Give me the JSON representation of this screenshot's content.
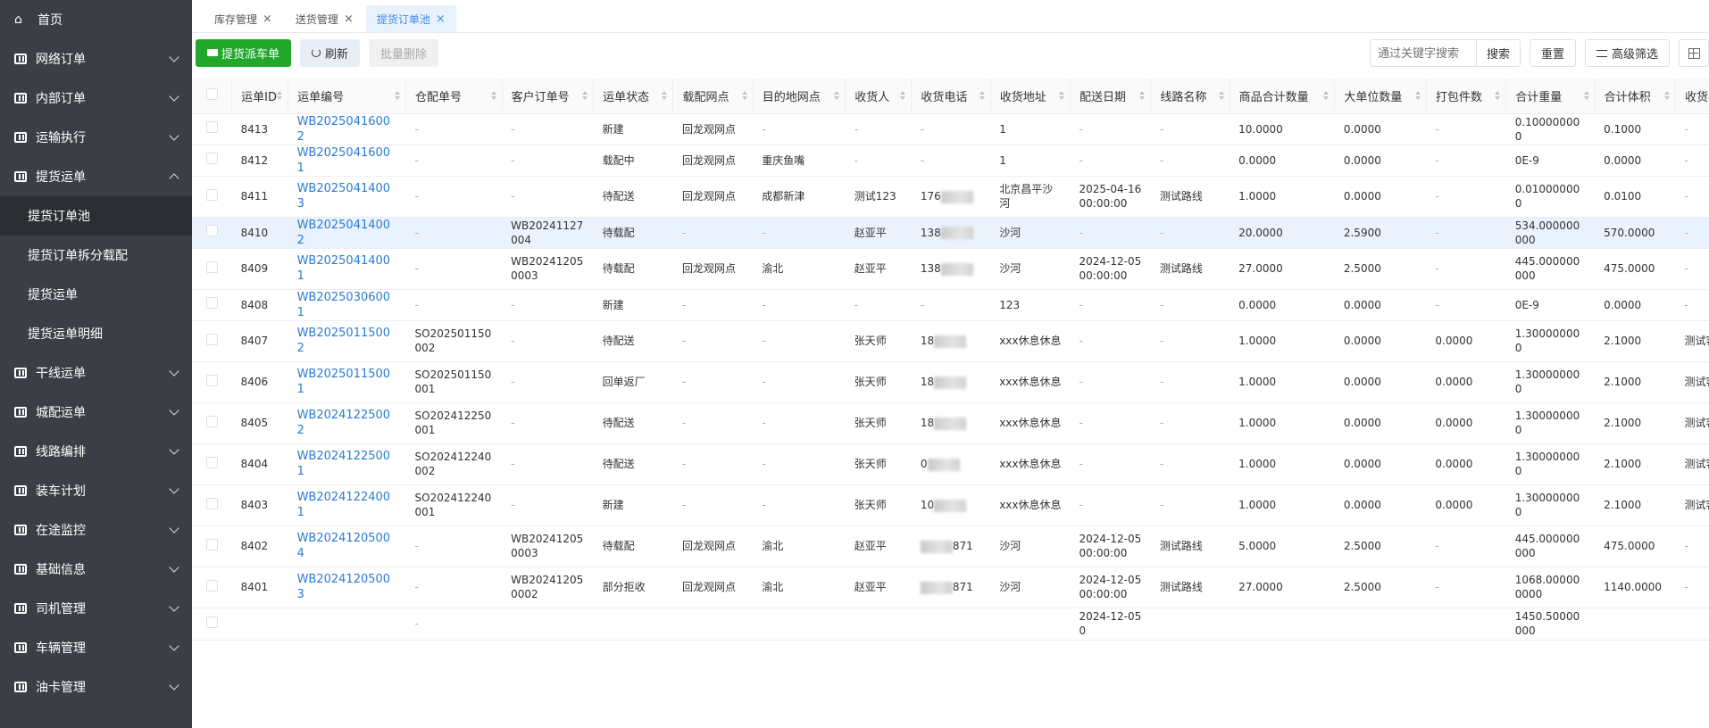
{
  "sidebar": {
    "home": "首页",
    "items": [
      {
        "label": "网络订单",
        "expanded": false
      },
      {
        "label": "内部订单",
        "expanded": false
      },
      {
        "label": "运输执行",
        "expanded": false
      },
      {
        "label": "提货运单",
        "expanded": true
      }
    ],
    "sub_items": [
      {
        "label": "提货订单池",
        "active": true
      },
      {
        "label": "提货订单拆分载配",
        "active": false
      },
      {
        "label": "提货运单",
        "active": false
      },
      {
        "label": "提货运单明细",
        "active": false
      }
    ],
    "items_after": [
      {
        "label": "干线运单"
      },
      {
        "label": "城配运单"
      },
      {
        "label": "线路编排"
      },
      {
        "label": "装车计划"
      },
      {
        "label": "在途监控"
      },
      {
        "label": "基础信息"
      },
      {
        "label": "司机管理"
      },
      {
        "label": "车辆管理"
      },
      {
        "label": "油卡管理"
      }
    ]
  },
  "tabs": [
    {
      "label": "库存管理",
      "active": false
    },
    {
      "label": "送货管理",
      "active": false
    },
    {
      "label": "提货订单池",
      "active": true
    }
  ],
  "toolbar": {
    "dispatch_label": "提货派车单",
    "refresh_label": "刷新",
    "batch_delete_label": "批量删除",
    "search_placeholder": "通过关键字搜索",
    "search_label": "搜索",
    "reset_label": "重置",
    "advanced_filter_label": "高级筛选"
  },
  "table": {
    "columns": [
      "运单ID",
      "运单编号",
      "仓配单号",
      "客户订单号",
      "运单状态",
      "载配网点",
      "目的地网点",
      "收货人",
      "收货电话",
      "收货地址",
      "配送日期",
      "线路名称",
      "商品合计数量",
      "大单位数量",
      "打包件数",
      "合计重量",
      "合计体积",
      "收货客"
    ],
    "rows": [
      {
        "id": "8413",
        "no": "WB20250416002",
        "wh": "-",
        "cust": "-",
        "status": "新建",
        "site": "回龙观网点",
        "dest": "-",
        "recv": "-",
        "phone": "-",
        "addr": "1",
        "date": "-",
        "line": "-",
        "qty": "10.0000",
        "big": "0.0000",
        "pack": "-",
        "weight": "0.100000000",
        "vol": "0.1000",
        "rc": "-"
      },
      {
        "id": "8412",
        "no": "WB20250416001",
        "wh": "-",
        "cust": "-",
        "status": "载配中",
        "site": "回龙观网点",
        "dest": "重庆鱼嘴",
        "recv": "-",
        "phone": "-",
        "addr": "1",
        "date": "-",
        "line": "-",
        "qty": "0.0000",
        "big": "0.0000",
        "pack": "-",
        "weight": "0E-9",
        "vol": "0.0000",
        "rc": "-"
      },
      {
        "id": "8411",
        "no": "WB20250414003",
        "wh": "-",
        "cust": "-",
        "status": "待配送",
        "site": "回龙观网点",
        "dest": "成都新津",
        "recv": "测试123",
        "phone": "176",
        "addr": "北京昌平沙河",
        "date": "2025-04-16 00:00:00",
        "line": "测试路线",
        "qty": "1.0000",
        "big": "0.0000",
        "pack": "-",
        "weight": "0.010000000",
        "vol": "0.0100",
        "rc": "-"
      },
      {
        "id": "8410",
        "no": "WB20250414002",
        "wh": "-",
        "cust": "WB20241127004",
        "status": "待载配",
        "site": "-",
        "dest": "-",
        "recv": "赵亚平",
        "phone": "138",
        "addr": "沙河",
        "date": "-",
        "line": "-",
        "qty": "20.0000",
        "big": "2.5900",
        "pack": "-",
        "weight": "534.000000000",
        "vol": "570.0000",
        "rc": "-"
      },
      {
        "id": "8409",
        "no": "WB20250414001",
        "wh": "-",
        "cust": "WB202412050003",
        "status": "待载配",
        "site": "回龙观网点",
        "dest": "渝北",
        "recv": "赵亚平",
        "phone": "138",
        "addr": "沙河",
        "date": "2024-12-05 00:00:00",
        "line": "测试路线",
        "qty": "27.0000",
        "big": "2.5000",
        "pack": "-",
        "weight": "445.000000000",
        "vol": "475.0000",
        "rc": "-"
      },
      {
        "id": "8408",
        "no": "WB20250306001",
        "wh": "-",
        "cust": "-",
        "status": "新建",
        "site": "-",
        "dest": "-",
        "recv": "-",
        "phone": "-",
        "addr": "123",
        "date": "-",
        "line": "-",
        "qty": "0.0000",
        "big": "0.0000",
        "pack": "-",
        "weight": "0E-9",
        "vol": "0.0000",
        "rc": "-"
      },
      {
        "id": "8407",
        "no": "WB20250115002",
        "wh": "SO202501150002",
        "cust": "-",
        "status": "待配送",
        "site": "-",
        "dest": "-",
        "recv": "张天师",
        "phone": "18",
        "addr": "xxx休息休息",
        "date": "-",
        "line": "-",
        "qty": "1.0000",
        "big": "0.0000",
        "pack": "0.0000",
        "weight": "1.300000000",
        "vol": "2.1000",
        "rc": "测试客"
      },
      {
        "id": "8406",
        "no": "WB20250115001",
        "wh": "SO202501150001",
        "cust": "-",
        "status": "回单返厂",
        "site": "-",
        "dest": "-",
        "recv": "张天师",
        "phone": "18",
        "addr": "xxx休息休息",
        "date": "-",
        "line": "-",
        "qty": "1.0000",
        "big": "0.0000",
        "pack": "0.0000",
        "weight": "1.300000000",
        "vol": "2.1000",
        "rc": "测试客"
      },
      {
        "id": "8405",
        "no": "WB20241225002",
        "wh": "SO202412250001",
        "cust": "-",
        "status": "待配送",
        "site": "-",
        "dest": "-",
        "recv": "张天师",
        "phone": "18",
        "addr": "xxx休息休息",
        "date": "-",
        "line": "-",
        "qty": "1.0000",
        "big": "0.0000",
        "pack": "0.0000",
        "weight": "1.300000000",
        "vol": "2.1000",
        "rc": "测试客"
      },
      {
        "id": "8404",
        "no": "WB20241225001",
        "wh": "SO202412240002",
        "cust": "-",
        "status": "待配送",
        "site": "-",
        "dest": "-",
        "recv": "张天师",
        "phone": "0",
        "addr": "xxx休息休息",
        "date": "-",
        "line": "-",
        "qty": "1.0000",
        "big": "0.0000",
        "pack": "0.0000",
        "weight": "1.300000000",
        "vol": "2.1000",
        "rc": "测试客"
      },
      {
        "id": "8403",
        "no": "WB20241224001",
        "wh": "SO202412240001",
        "cust": "-",
        "status": "新建",
        "site": "-",
        "dest": "-",
        "recv": "张天师",
        "phone": "10",
        "addr": "xxx休息休息",
        "date": "-",
        "line": "-",
        "qty": "1.0000",
        "big": "0.0000",
        "pack": "0.0000",
        "weight": "1.300000000",
        "vol": "2.1000",
        "rc": "测试客"
      },
      {
        "id": "8402",
        "no": "WB20241205004",
        "wh": "-",
        "cust": "WB202412050003",
        "status": "待载配",
        "site": "回龙观网点",
        "dest": "渝北",
        "recv": "赵亚平",
        "phone": "871",
        "addr": "沙河",
        "date": "2024-12-05 00:00:00",
        "line": "测试路线",
        "qty": "5.0000",
        "big": "2.5000",
        "pack": "-",
        "weight": "445.000000000",
        "vol": "475.0000",
        "rc": "-"
      },
      {
        "id": "8401",
        "no": "WB20241205003",
        "wh": "-",
        "cust": "WB202412050002",
        "status": "部分拒收",
        "site": "回龙观网点",
        "dest": "渝北",
        "recv": "赵亚平",
        "phone": "871",
        "addr": "沙河",
        "date": "2024-12-05 00:00:00",
        "line": "测试路线",
        "qty": "27.0000",
        "big": "2.5000",
        "pack": "-",
        "weight": "1068.000000000",
        "vol": "1140.0000",
        "rc": "-"
      },
      {
        "id": "",
        "no": "",
        "wh": "-",
        "cust": "",
        "status": "",
        "site": "",
        "dest": "",
        "recv": "",
        "phone": "",
        "addr": "",
        "date": "2024-12-05 0",
        "line": "",
        "qty": "",
        "big": "",
        "pack": "",
        "weight": "1450.50000000",
        "vol": "",
        "rc": ""
      }
    ]
  },
  "colors": {
    "sidebar_bg": "#3b3f45",
    "sidebar_active": "#2b2e33",
    "primary_green": "#21a82b",
    "link_blue": "#2a7bd4",
    "row_highlight": "#eaf3fd"
  }
}
